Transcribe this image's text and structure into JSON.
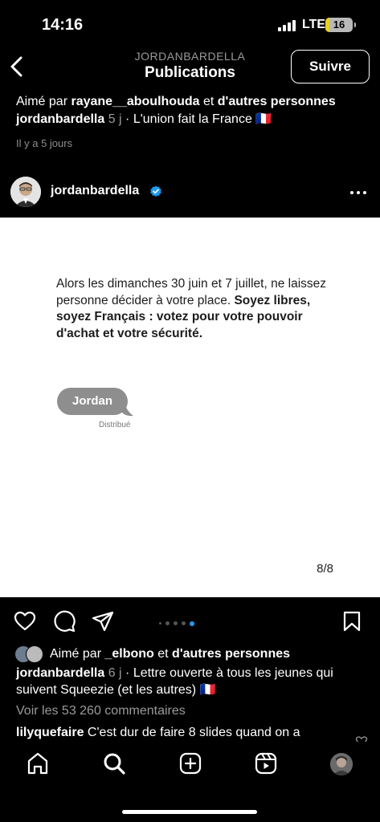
{
  "status_bar": {
    "time": "14:16",
    "network": "LTE",
    "battery": "16",
    "battery_level": 0.16
  },
  "header": {
    "username": "JORDANBARDELLA",
    "title": "Publications",
    "follow_label": "Suivre"
  },
  "previous_post": {
    "liked_prefix": "Aimé par ",
    "liked_user": "rayane__aboulhouda",
    "liked_mid": " et ",
    "liked_others": "d'autres personnes",
    "caption_user": "jordanbardella",
    "caption_age": " 5 j",
    "caption_text": " · L'union fait la France 🇫🇷",
    "time_ago": "Il y a 5 jours"
  },
  "post": {
    "username": "jordanbardella",
    "letter_plain": "Alors les dimanches 30 juin et 7 juillet, ne laissez personne décider à votre place. ",
    "letter_bold": "Soyez libres, soyez Français : votez pour votre pouvoir d'achat et votre sécurité.",
    "bubble_name": "Jordan",
    "delivered": "Distribué",
    "page": "8/8",
    "carousel": {
      "count": 5,
      "active_index": 4
    }
  },
  "engagement": {
    "liked_prefix": "Aimé par ",
    "liked_user": "_elbono",
    "liked_mid": " et ",
    "liked_others": "d'autres personnes",
    "caption_user": "jordanbardella",
    "caption_age": " 6 j",
    "caption_text": " · Lettre ouverte à tous les jeunes qui suivent Squeezie (et les autres) 🇫🇷",
    "comments": "Voir les 53 260 commentaires",
    "first_comment_user": "lilyquefaire",
    "first_comment_text": " C'est dur de faire 8 slides quand on a"
  },
  "icons": {
    "back": "chevron-left-icon",
    "verified": "verified-badge-icon",
    "more": "more-icon",
    "like": "heart-icon",
    "comment": "comment-icon",
    "share": "send-icon",
    "save": "bookmark-icon",
    "home": "home-icon",
    "search": "search-icon",
    "create": "create-icon",
    "reels": "reels-icon"
  },
  "colors": {
    "verified_blue": "#1d9bf0",
    "background": "#000000",
    "battery_fill": "#e6d21f"
  }
}
